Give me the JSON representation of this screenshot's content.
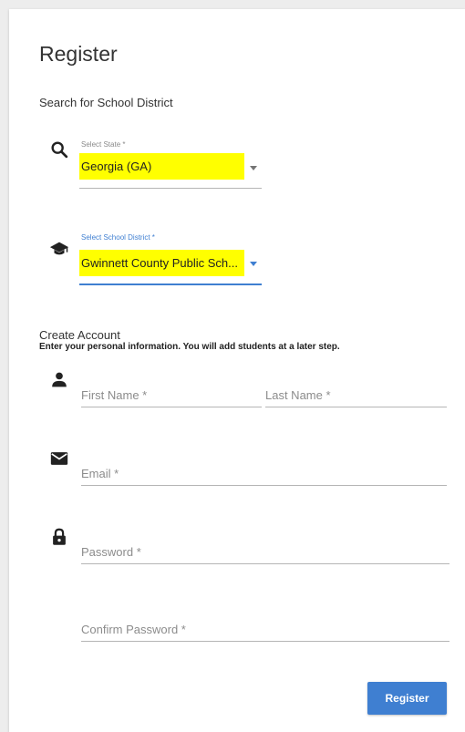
{
  "page": {
    "title": "Register",
    "search_label": "Search for School District"
  },
  "state_select": {
    "label": "Select State *",
    "value": "Georgia (GA)",
    "icon": "search-icon"
  },
  "district_select": {
    "label": "Select School District *",
    "value": "Gwinnett County Public Sch...",
    "icon": "graduation-cap-icon"
  },
  "account": {
    "heading": "Create Account",
    "instructions": "Enter your personal information.  You will add students at a later step."
  },
  "fields": {
    "first_name": "First Name *",
    "last_name": "Last Name *",
    "email": "Email *",
    "password": "Password *",
    "confirm_password": "Confirm Password *"
  },
  "icons": {
    "person": "person-icon",
    "email": "envelope-icon",
    "lock": "lock-icon"
  },
  "colors": {
    "accent": "#3f7fd1",
    "highlight": "#ffff00"
  },
  "register_button": "Register"
}
